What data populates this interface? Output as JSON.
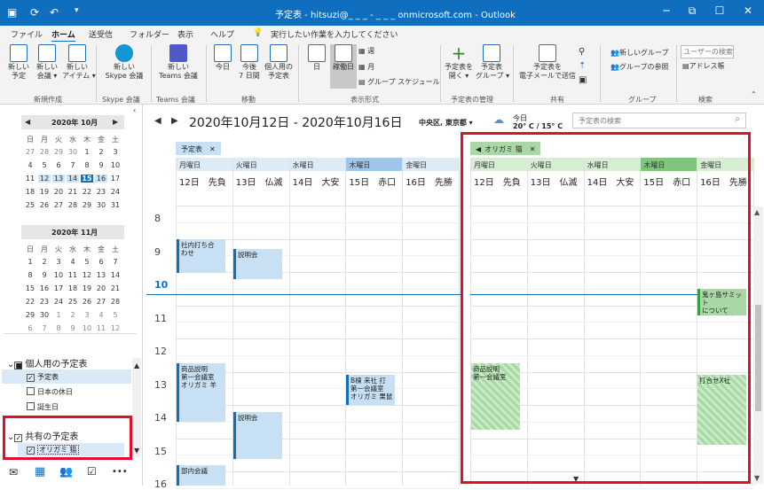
{
  "titlebar": {
    "title": "予定表 - hitsuzi@_ _ _ - _ _ _ onmicrosoft.com - Outlook",
    "minimize": "─",
    "restore": "☐",
    "close": "✕",
    "icons": [
      "save-icon",
      "refresh-icon",
      "undo-icon",
      "customize-icon"
    ]
  },
  "ribbon_tabs": [
    "ファイル",
    "ホーム",
    "送受信",
    "フォルダー",
    "表示",
    "ヘルプ"
  ],
  "tell_me": "実行したい作業を入力してください",
  "ribbon": {
    "new_appt": "新しい\n予定",
    "new_meeting": "新しい\n会議 ▾",
    "new_items": "新しい\nアイテム ▾",
    "group_new": "新規作成",
    "skype": "新しい\nSkype 会議",
    "group_skype": "Skype 会議",
    "teams": "新しい\nTeams 会議",
    "group_teams": "Teams 会議",
    "today": "今日",
    "next7": "今後\n7 日間",
    "personal": "個人用の\n予定表",
    "group_move": "移動",
    "day": "日",
    "workweek": "稼働日",
    "week": "週",
    "month": "月",
    "schedule": "グループ スケジュール",
    "group_view": "表示形式",
    "open_cal": "予定表を\n開く ▾",
    "cal_groups": "予定表\nグループ ▾",
    "group_manage": "予定表の管理",
    "email_cal": "予定表を\n電子メールで送信",
    "group_share": "共有",
    "new_group": "新しいグループ",
    "browse_groups": "グループの参照",
    "group_groups": "グループ",
    "search_people": "ユーザーの検索",
    "address_book": "アドレス帳",
    "group_find": "検索"
  },
  "mini_cal": {
    "oct_title": "2020年 10月",
    "nov_title": "2020年 11月",
    "weekdays": [
      "日",
      "月",
      "火",
      "水",
      "木",
      "金",
      "土"
    ],
    "oct_rows": [
      [
        "27",
        "28",
        "29",
        "30",
        "1",
        "2",
        "3"
      ],
      [
        "4",
        "5",
        "6",
        "7",
        "8",
        "9",
        "10"
      ],
      [
        "11",
        "12",
        "13",
        "14",
        "15",
        "16",
        "17"
      ],
      [
        "18",
        "19",
        "20",
        "21",
        "22",
        "23",
        "24"
      ],
      [
        "25",
        "26",
        "27",
        "28",
        "29",
        "30",
        "31"
      ]
    ],
    "nov_rows": [
      [
        "1",
        "2",
        "3",
        "4",
        "5",
        "6",
        "7"
      ],
      [
        "8",
        "9",
        "10",
        "11",
        "12",
        "13",
        "14"
      ],
      [
        "15",
        "16",
        "17",
        "18",
        "19",
        "20",
        "21"
      ],
      [
        "22",
        "23",
        "24",
        "25",
        "26",
        "27",
        "28"
      ],
      [
        "29",
        "30",
        "1",
        "2",
        "3",
        "4",
        "5"
      ],
      [
        "6",
        "7",
        "8",
        "9",
        "10",
        "11",
        "12"
      ]
    ]
  },
  "folders": {
    "personal_head": "個人用の予定表",
    "personal_items": [
      {
        "label": "予定表",
        "checked": true
      },
      {
        "label": "日本の休日",
        "checked": false
      },
      {
        "label": "誕生日",
        "checked": false
      }
    ],
    "shared_head": "共有の予定表",
    "shared_items": [
      {
        "label": "オリガミ 猫",
        "checked": true
      }
    ]
  },
  "navbar": {
    "icons": [
      "mail-icon",
      "calendar-icon",
      "people-icon",
      "tasks-icon",
      "more-icon"
    ],
    "more": "•••"
  },
  "calendar": {
    "date_range": "2020年10月12日 - 2020年10月16日",
    "location": "中央区, 東京都 ▾",
    "weather_label": "今日",
    "weather_temp": "20° C / 15° C",
    "search_placeholder": "予定表の検索",
    "tab_left": "予定表",
    "tab_right": "オリガミ 猫",
    "tab_close": "✕",
    "tab_back": "◀",
    "day_names": [
      "月曜日",
      "火曜日",
      "水曜日",
      "木曜日",
      "金曜日"
    ],
    "dates": [
      "12日",
      "13日",
      "14日",
      "15日",
      "16日"
    ],
    "rokuyo": [
      "先負",
      "仏滅",
      "大安",
      "赤口",
      "先勝"
    ],
    "hours": [
      "8",
      "9",
      "10",
      "11",
      "12",
      "13",
      "14",
      "15",
      "16"
    ],
    "left_events": [
      {
        "text": "社内打ち合\nわせ"
      },
      {
        "text": "説明会"
      },
      {
        "text": "商品説明\n第一会議室\nオリガミ 羊"
      },
      {
        "text": "B棟 来社 打\n第一会議室\nオリガミ 栗鼠"
      },
      {
        "text": "説明会"
      },
      {
        "text": "部内会議"
      }
    ],
    "right_events": [
      {
        "text": "鬼ヶ島サミット\nについて\n第一会議室"
      },
      {
        "text": "商品説明\n第一会議室"
      },
      {
        "text": "打合せX社"
      }
    ]
  },
  "colors": {
    "accent": "#106ebe",
    "event_blue": "#c7e0f4",
    "event_green": "#a9d8a6",
    "highlight_red": "#e0102c"
  }
}
